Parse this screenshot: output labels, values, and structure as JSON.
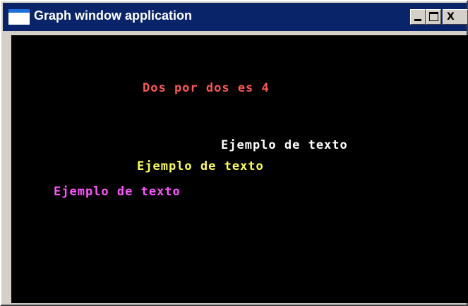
{
  "window": {
    "title": "Graph window application",
    "app_icon": "window-icon",
    "controls": {
      "minimize_icon": "minimize-icon",
      "maximize_icon": "maximize-icon",
      "close_label": "X"
    }
  },
  "canvas": {
    "background": "#000000",
    "texts": [
      {
        "text": "Dos por dos es 4",
        "color": "#ff5555"
      },
      {
        "text": "Ejemplo de texto",
        "color": "#ffffff"
      },
      {
        "text": "Ejemplo de texto",
        "color": "#ffff55"
      },
      {
        "text": "Ejemplo de texto",
        "color": "#ff55ff"
      }
    ]
  }
}
